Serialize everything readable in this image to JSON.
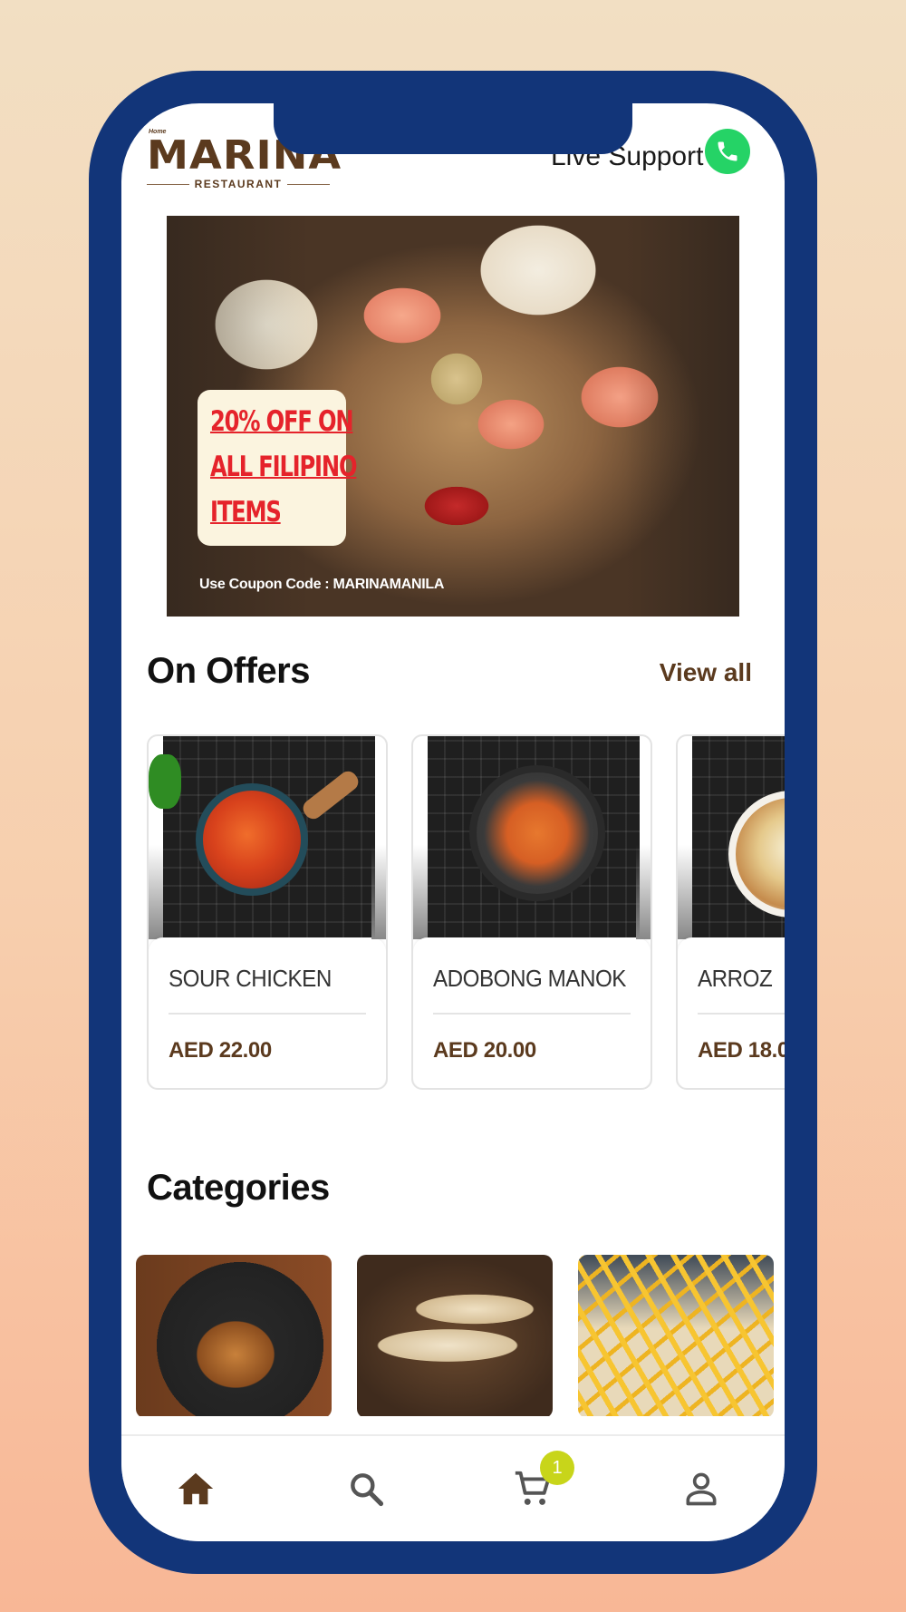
{
  "header": {
    "logo_badge": "Home",
    "logo_name": "MARINA",
    "logo_subtitle": "RESTAURANT",
    "support_label": "Live Support",
    "support_icon": "whatsapp-icon"
  },
  "banner": {
    "promo_lines": [
      "20% OFF ON",
      "ALL FILIPINO",
      "ITEMS"
    ],
    "coupon_text": "Use Coupon Code : MARINAMANILA"
  },
  "offers": {
    "title": "On Offers",
    "view_all_label": "View all",
    "items": [
      {
        "name": "SOUR CHICKEN",
        "price": "AED 22.00"
      },
      {
        "name": "ADOBONG MANOK",
        "price": "AED 20.00"
      },
      {
        "name": "ARROZ",
        "price": "AED 18.0"
      }
    ]
  },
  "categories": {
    "title": "Categories"
  },
  "bottom_nav": {
    "items": [
      "home-icon",
      "search-icon",
      "cart-icon",
      "profile-icon"
    ],
    "cart_count": "1",
    "active_color": "#5b3a1e",
    "inactive_color": "#555555",
    "badge_color": "#c8d51a"
  },
  "colors": {
    "brand_brown": "#5b3a1e",
    "frame_blue": "#123579",
    "promo_red": "#e5232b",
    "whatsapp_green": "#25d366"
  }
}
